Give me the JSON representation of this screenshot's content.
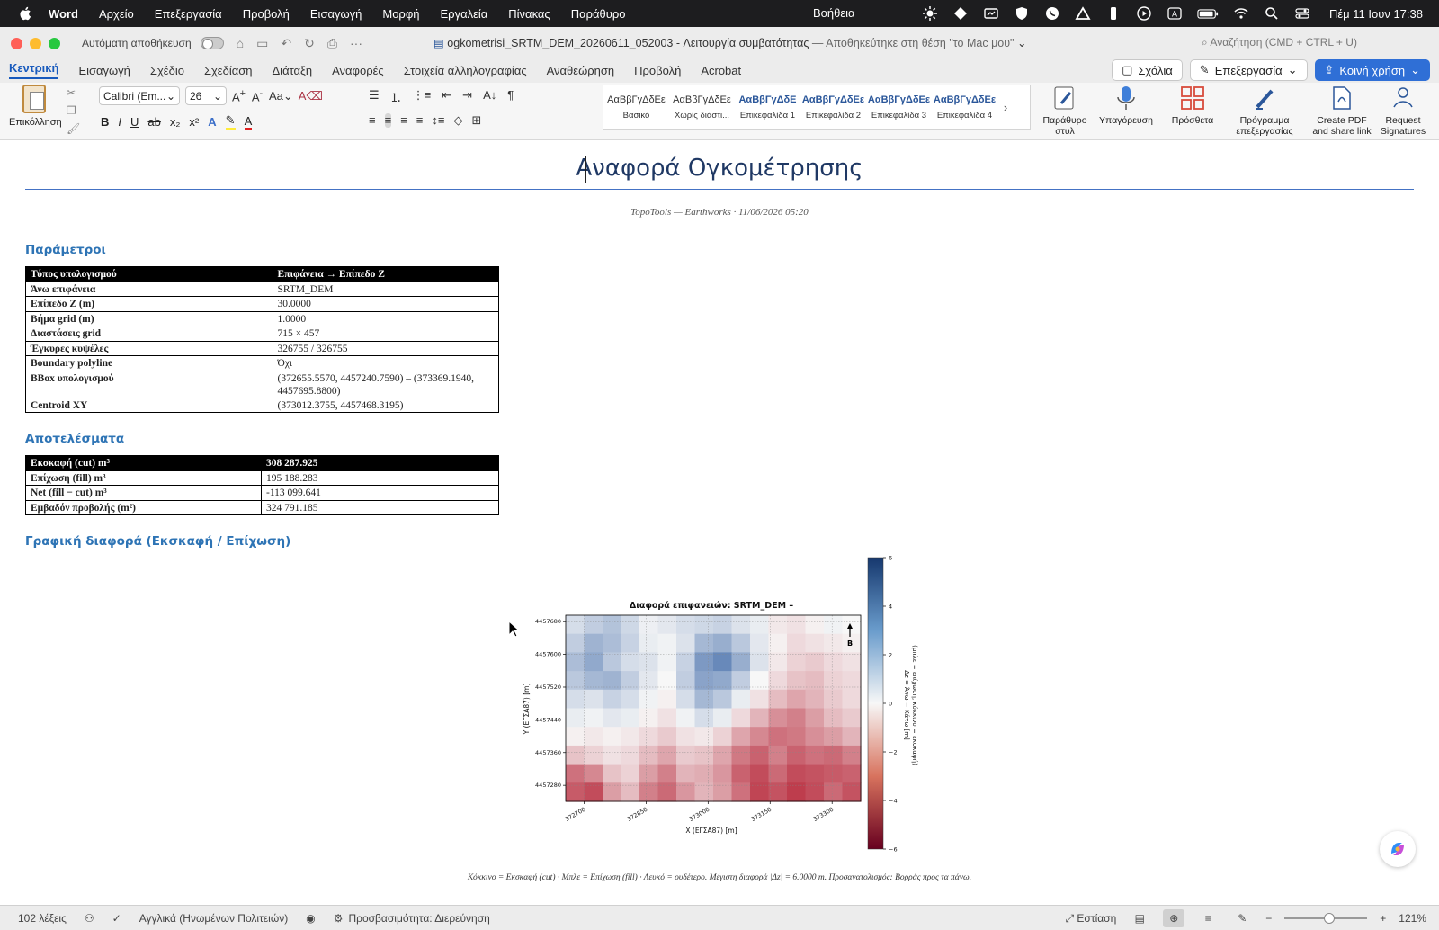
{
  "menubar": {
    "app": "Word",
    "items": [
      "Αρχείο",
      "Επεξεργασία",
      "Προβολή",
      "Εισαγωγή",
      "Μορφή",
      "Εργαλεία",
      "Πίνακας",
      "Παράθυρο"
    ],
    "help": "Βοήθεια",
    "clock": "Πέμ 11 Ιουν  17:38"
  },
  "titlebar": {
    "autosave_label": "Αυτόματη αποθήκευση",
    "filename": "ogkometrisi_SRTM_DEM_20260611_052003",
    "mode": "  -  Λειτουργία συμβατότητας",
    "saved_status": " — Αποθηκεύτηκε στη θέση \"το Mac μου\"",
    "search_placeholder": "Αναζήτηση (CMD + CTRL + U)"
  },
  "ribbon_tabs": [
    "Κεντρική",
    "Εισαγωγή",
    "Σχέδιο",
    "Σχεδίαση",
    "Διάταξη",
    "Αναφορές",
    "Στοιχεία αλληλογραφίας",
    "Αναθεώρηση",
    "Προβολή",
    "Acrobat"
  ],
  "ribbon_buttons": {
    "comments": "Σχόλια",
    "editing": "Επεξεργασία",
    "share": "Κοινή χρήση"
  },
  "ribbon": {
    "paste_label": "Επικόλληση",
    "font_name": "Calibri (Em...",
    "font_size": "26",
    "styles": [
      {
        "sample": "ΑαΒβΓγΔδΕε",
        "name": "Βασικό",
        "heading": false
      },
      {
        "sample": "ΑαΒβΓγΔδΕε",
        "name": "Χωρίς διάστι...",
        "heading": false
      },
      {
        "sample": "ΑαΒβΓγΔδΕ",
        "name": "Επικεφαλίδα 1",
        "heading": true
      },
      {
        "sample": "ΑαΒβΓγΔδΕε",
        "name": "Επικεφαλίδα 2",
        "heading": true
      },
      {
        "sample": "ΑαΒβΓγΔδΕε",
        "name": "Επικεφαλίδα 3",
        "heading": true
      },
      {
        "sample": "ΑαΒβΓγΔδΕε",
        "name": "Επικεφαλίδα 4",
        "heading": true
      }
    ],
    "styles_pane": "Παράθυρο\nστυλ",
    "dictate": "Υπαγόρευση",
    "addins": "Πρόσθετα",
    "editor": "Πρόγραμμα\nεπεξεργασίας",
    "create_pdf": "Create PDF\nand share link",
    "request_sig": "Request\nSignatures"
  },
  "document": {
    "title": "Αναφορά Ογκομέτρησης",
    "meta": "TopoTools — Earthworks · 11/06/2026 05:20",
    "params_heading": "Παράμετροι",
    "params": [
      [
        "Τύπος υπολογισμού",
        "Επιφάνεια → Επίπεδο Z"
      ],
      [
        "Άνω επιφάνεια",
        "SRTM_DEM"
      ],
      [
        "Επίπεδο Z (m)",
        "30.0000"
      ],
      [
        "Βήμα grid (m)",
        "1.0000"
      ],
      [
        "Διαστάσεις grid",
        "715 × 457"
      ],
      [
        "Έγκυρες κυψέλες",
        "326755 / 326755"
      ],
      [
        "Boundary polyline",
        "Όχι"
      ],
      [
        "BBox υπολογισμού",
        "(372655.5570, 4457240.7590) – (373369.1940, 4457695.8800)"
      ],
      [
        "Centroid XY",
        "(373012.3755, 4457468.3195)"
      ]
    ],
    "results_heading": "Αποτελέσματα",
    "results": [
      [
        "Εκσκαφή (cut) m³",
        "308 287.925"
      ],
      [
        "Επίχωση (fill) m³",
        "195 188.283"
      ],
      [
        "Net (fill − cut) m³",
        "-113 099.641"
      ],
      [
        "Εμβαδόν προβολής (m²)",
        "324 791.185"
      ]
    ],
    "graph_heading": "Γραφική διαφορά (Εκσκαφή / Επίχωση)",
    "footnote": "Κόκκινο = Εκσκαφή (cut)  ·  Μπλε = Επίχωση (fill)  ·  Λευκό = ουδέτερο.  Μέγιστη διαφορά |Δz| = 6.0000 m.  Προσανατολισμός: Βορράς προς τα πάνω."
  },
  "chart_data": {
    "type": "heatmap",
    "title": "Διαφορά επιφανειών:  SRTM_DEM –",
    "xlabel": "X (ΕΓΣΑ87)  [m]",
    "ylabel": "Υ (ΕΓΣΑ87)  [m]",
    "x_ticks": [
      "372700",
      "372850",
      "373000",
      "373150",
      "373300"
    ],
    "y_ticks": [
      "4457680",
      "4457600",
      "4457520",
      "4457440",
      "4457360",
      "4457280"
    ],
    "colorbar_ticks": [
      "6",
      "4",
      "2",
      "0",
      "−2",
      "−4",
      "−6"
    ],
    "colorbar_label": "Δz = Άνω − Κάτω  [m]",
    "colorbar_label2": "(μπλε = επίχωση, κόκκινο = εκσκαφή)",
    "zlim": [
      -6,
      6
    ],
    "north_label": "B",
    "colors": {
      "positive": "#2b5aa0",
      "negative": "#b2182b",
      "neutral": "#f7f7f7"
    },
    "grid": true,
    "cells": [
      [
        1.0,
        1.6,
        2.0,
        1.2,
        0.3,
        0.6,
        1.0,
        1.2,
        1.4,
        0.8,
        0.4,
        -0.4,
        -0.6,
        -0.2,
        0.2,
        0.0
      ],
      [
        1.6,
        2.6,
        2.2,
        1.4,
        0.4,
        0.2,
        0.8,
        2.4,
        2.8,
        1.8,
        0.6,
        -0.2,
        -0.8,
        -0.6,
        -0.4,
        -0.2
      ],
      [
        2.2,
        3.0,
        1.8,
        1.0,
        0.8,
        0.2,
        1.4,
        3.6,
        4.2,
        2.8,
        0.8,
        -0.4,
        -1.0,
        -1.2,
        -0.8,
        -0.6
      ],
      [
        1.8,
        2.4,
        2.6,
        1.6,
        0.6,
        0.0,
        1.6,
        3.2,
        3.0,
        1.6,
        0.0,
        -0.8,
        -1.4,
        -1.6,
        -1.0,
        -0.8
      ],
      [
        1.0,
        0.8,
        1.4,
        1.0,
        0.2,
        -0.2,
        1.0,
        2.4,
        1.8,
        0.4,
        -0.6,
        -1.6,
        -2.2,
        -1.8,
        -1.2,
        -0.8
      ],
      [
        0.4,
        0.2,
        0.6,
        0.4,
        -0.2,
        -0.6,
        0.2,
        1.0,
        0.4,
        -0.8,
        -1.8,
        -2.8,
        -3.2,
        -2.4,
        -1.6,
        -1.2
      ],
      [
        -0.2,
        -0.4,
        -0.2,
        -0.4,
        -0.8,
        -1.2,
        -0.6,
        -0.4,
        -1.0,
        -2.2,
        -3.0,
        -3.6,
        -3.4,
        -2.8,
        -2.4,
        -1.8
      ],
      [
        -1.4,
        -1.0,
        -0.6,
        -0.8,
        -1.6,
        -2.2,
        -1.2,
        -1.4,
        -2.2,
        -3.4,
        -4.0,
        -3.2,
        -4.0,
        -3.6,
        -3.8,
        -3.2
      ],
      [
        -3.6,
        -3.0,
        -1.4,
        -1.0,
        -2.4,
        -3.2,
        -1.8,
        -2.0,
        -2.6,
        -4.0,
        -4.6,
        -3.8,
        -4.6,
        -4.4,
        -4.2,
        -4.0
      ],
      [
        -4.2,
        -4.6,
        -2.4,
        -1.6,
        -3.2,
        -3.8,
        -2.6,
        -1.8,
        -2.4,
        -3.6,
        -4.8,
        -4.4,
        -5.0,
        -4.6,
        -3.8,
        -4.4
      ]
    ]
  },
  "statusbar": {
    "words": "102 λέξεις",
    "language": "Αγγλικά (Ηνωμένων Πολιτειών)",
    "accessibility": "Προσβασιμότητα: Διερεύνηση",
    "focus": "Εστίαση",
    "zoom": "121%"
  }
}
